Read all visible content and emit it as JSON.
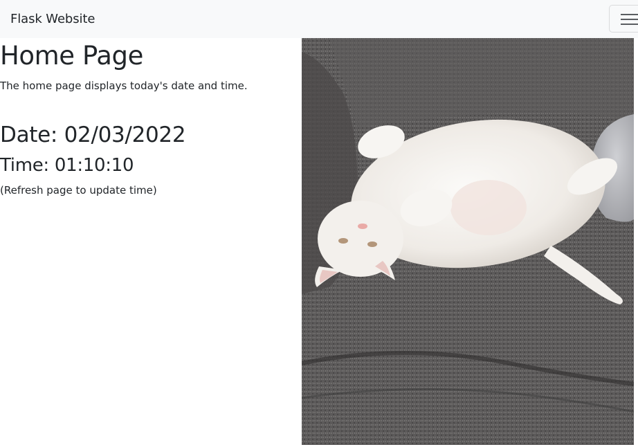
{
  "navbar": {
    "brand": "Flask Website",
    "toggler_icon": "hamburger-icon"
  },
  "main": {
    "title": "Home Page",
    "description": "The home page displays today's date and time.",
    "date_text": "Date: 02/03/2022",
    "time_text": "Time: 01:10:10",
    "refresh_note": "(Refresh page to update time)"
  },
  "image": {
    "subject": "cat-photo",
    "alt": "White cat lying on its back on a gray couch"
  },
  "colors": {
    "navbar_bg": "#f8f9fa",
    "text": "#212529",
    "couch": "#5a5858",
    "cat": "#f4f2ef"
  }
}
